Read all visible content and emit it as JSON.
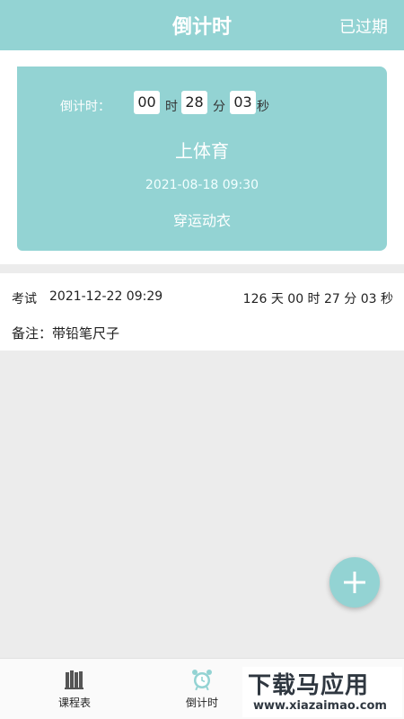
{
  "header": {
    "title": "倒计时",
    "action_label": "已过期",
    "color": "#93d3d3"
  },
  "card": {
    "countdown_label": "倒计时：",
    "hours": "00",
    "hours_unit": "时",
    "minutes": "28",
    "minutes_unit": "分",
    "seconds": "03",
    "seconds_unit": "秒",
    "title": "上体育",
    "datetime": "2021-08-18 09:30",
    "note": "穿运动衣"
  },
  "list": [
    {
      "type": "考试",
      "datetime": "2021-12-22 09:29",
      "remaining": "126 天 00 时 27 分 03 秒",
      "note": "备注：带铅笔尺子"
    }
  ],
  "fab": {
    "icon": "plus-icon"
  },
  "bottom_nav": {
    "items": [
      {
        "label": "课程表",
        "icon": "books-icon"
      },
      {
        "label": "倒计时",
        "icon": "alarm-clock-icon",
        "active": true
      },
      {
        "label": "",
        "icon": "settings-icon"
      }
    ]
  },
  "watermark": {
    "main": "下载马应用",
    "url": "www.xiazaimao.com"
  }
}
